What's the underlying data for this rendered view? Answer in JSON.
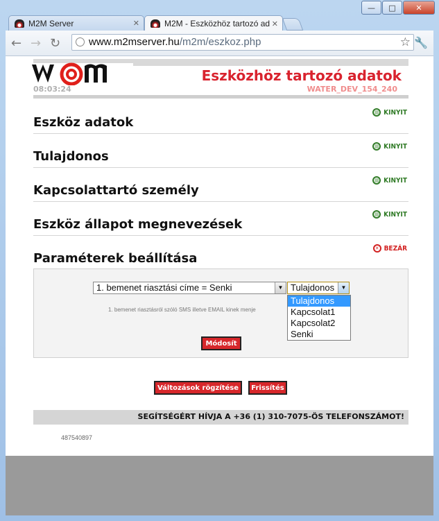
{
  "browser": {
    "tabs": [
      {
        "label": "M2M Server"
      },
      {
        "label": "M2M - Eszközhöz tartozó ad"
      }
    ],
    "url_host": "www.m2mserver.hu",
    "url_path": "/m2m/eszkoz.php"
  },
  "page": {
    "title": "Eszközhöz tartozó adatok",
    "time": "08:03:24",
    "device_id": "WATER_DEV_154_240",
    "sections": [
      {
        "name": "Eszköz adatok",
        "action": "KINYIT"
      },
      {
        "name": "Tulajdonos",
        "action": "KINYIT"
      },
      {
        "name": "Kapcsolattartó személy",
        "action": "KINYIT"
      },
      {
        "name": "Eszköz állapot megnevezések",
        "action": "KINYIT"
      },
      {
        "name": "Paraméterek beállítása",
        "action": "BEZÁR"
      }
    ],
    "param_select_value": "1. bemenet riasztási címe = Senki",
    "target_select_value": "Tulajdonos",
    "target_options": [
      "Tulajdonos",
      "Kapcsolat1",
      "Kapcsolat2",
      "Senki"
    ],
    "help_text": "1. bemenet riasztásról szóló SMS illetve EMAIL kinek menje",
    "modify_button": "Módosít",
    "save_button": "Változások rögzítése",
    "refresh_button": "Frissítés",
    "helpline": "SEGÍTSÉGÉRT HÍVJA A +36 (1) 310-7075-ÖS TELEFONSZÁMOT!",
    "counter": "487540897"
  },
  "colors": {
    "accent_red": "#d9232e",
    "open_green": "#2f7a25"
  }
}
